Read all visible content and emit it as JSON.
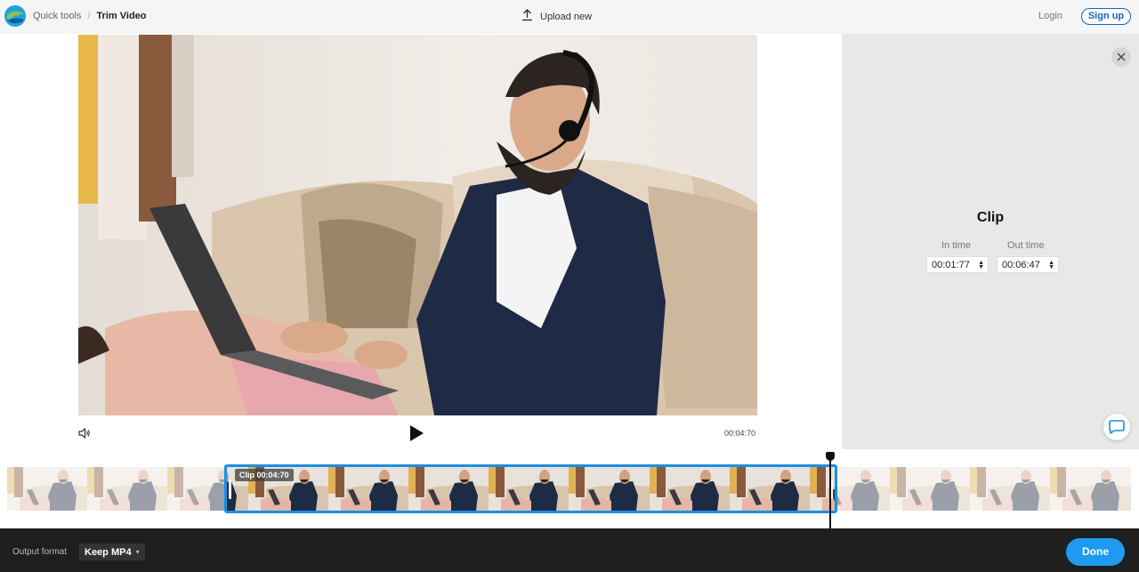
{
  "header": {
    "breadcrumb": [
      "Quick tools",
      "Trim Video"
    ],
    "separator": "/",
    "upload_label": "Upload new",
    "login_label": "Login",
    "signup_label": "Sign up"
  },
  "player": {
    "current_time": "00:04:70"
  },
  "clip_panel": {
    "title": "Clip",
    "in_label": "In time",
    "in_value": "00:01:77",
    "out_label": "Out time",
    "out_value": "00:06:47"
  },
  "timeline": {
    "clip_badge": "Clip 00:04:70",
    "frame_count": 14
  },
  "footer": {
    "output_label": "Output format",
    "format_value": "Keep MP4",
    "done_label": "Done"
  },
  "colors": {
    "accent": "#1a8fe3",
    "done_button": "#1e9bf0",
    "signup_border": "#1565c0",
    "footer_bg": "#1e1e1e"
  },
  "icons": [
    "logo-icon",
    "upload-icon",
    "volume-icon",
    "play-icon",
    "close-icon",
    "chat-icon",
    "chevron-down-icon",
    "spinner-arrows-icon"
  ]
}
